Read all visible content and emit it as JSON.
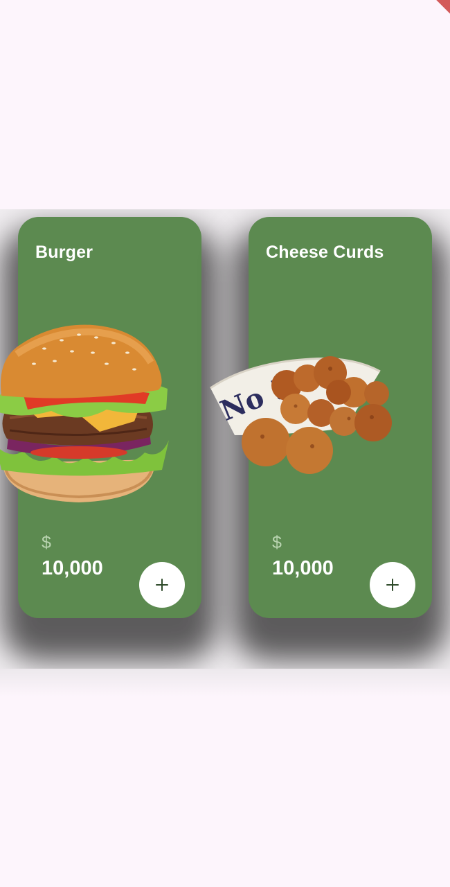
{
  "products": [
    {
      "name": "Burger",
      "currency": "$",
      "price": "10,000",
      "image_icon": "burger-image",
      "action_icon": "plus-icon"
    },
    {
      "name": "Cheese Curds",
      "currency": "$",
      "price": "10,000",
      "image_icon": "cheese-curds-image",
      "action_icon": "plus-icon"
    }
  ],
  "colors": {
    "card_background": "#5c8a50",
    "page_background": "#fdf5fc",
    "accent": "#d35a5a"
  }
}
